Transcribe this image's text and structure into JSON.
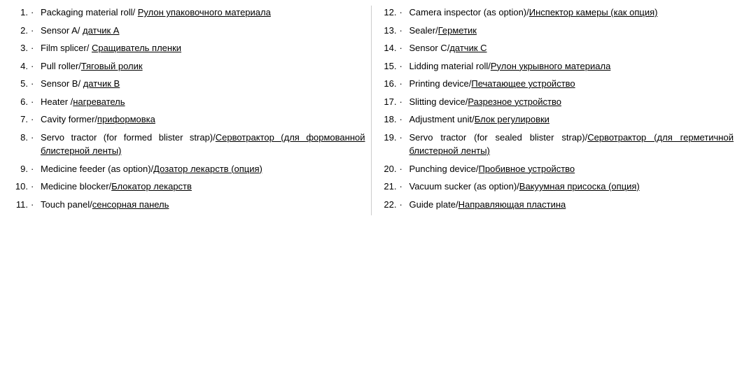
{
  "columns": [
    {
      "items": [
        {
          "number": "1.",
          "text_plain": "Packaging material roll/ ",
          "text_underline": "Рулон упаковочного материала"
        },
        {
          "number": "2.",
          "text_plain": "Sensor A/ ",
          "text_underline": "датчик А"
        },
        {
          "number": "3.",
          "text_plain": "Film splicer/ ",
          "text_underline": "Сращиватель пленки"
        },
        {
          "number": "4.",
          "text_plain": "Pull roller/",
          "text_underline": "Тяговый ролик"
        },
        {
          "number": "5.",
          "text_plain": "Sensor B/ ",
          "text_underline": "датчик В"
        },
        {
          "number": "6.",
          "text_plain": "Heater /",
          "text_underline": "нагреватель"
        },
        {
          "number": "7.",
          "text_plain": "Cavity former/",
          "text_underline": "приформовка"
        },
        {
          "number": "8.",
          "text_plain": "Servo tractor (for formed blister strap)/",
          "text_underline": "Сервотрактор (для формованной блистерной ленты)"
        },
        {
          "number": "9.",
          "text_plain": "Medicine feeder (as option)/",
          "text_underline": "Дозатор лекарств (опция)"
        },
        {
          "number": "10.",
          "text_plain": "Medicine blocker/",
          "text_underline": "Блокатор лекарств"
        },
        {
          "number": "11.",
          "text_plain": "Touch panel/",
          "text_underline": "сенсорная панель"
        }
      ]
    },
    {
      "items": [
        {
          "number": "12.",
          "text_plain": "Camera inspector (as option)/",
          "text_underline": "Инспектор камеры (как опция)"
        },
        {
          "number": "13.",
          "text_plain": "Sealer/",
          "text_underline": "Герметик"
        },
        {
          "number": "14.",
          "text_plain": "Sensor C/",
          "text_underline": "датчик С"
        },
        {
          "number": "15.",
          "text_plain": "Lidding material roll/",
          "text_underline": "Рулон укрывного материала"
        },
        {
          "number": "16.",
          "text_plain": "Printing device/",
          "text_underline": "Печатающее устройство"
        },
        {
          "number": "17.",
          "text_plain": "Slitting device/",
          "text_underline": "Разрезное устройство"
        },
        {
          "number": "18.",
          "text_plain": "Adjustment unit/",
          "text_underline": "Блок регулировки"
        },
        {
          "number": "19.",
          "text_plain": "Servo tractor (for sealed blister strap)/",
          "text_underline": "Сервотрактор (для герметичной блистерной ленты)"
        },
        {
          "number": "20.",
          "text_plain": "Punching device/",
          "text_underline": "Пробивное устройство"
        },
        {
          "number": "21.",
          "text_plain": "Vacuum sucker (as option)/",
          "text_underline": "Вакуумная присоска (опция)"
        },
        {
          "number": "22.",
          "text_plain": "Guide plate/",
          "text_underline": "Направляющая пластина"
        }
      ]
    }
  ],
  "bullet": "·"
}
